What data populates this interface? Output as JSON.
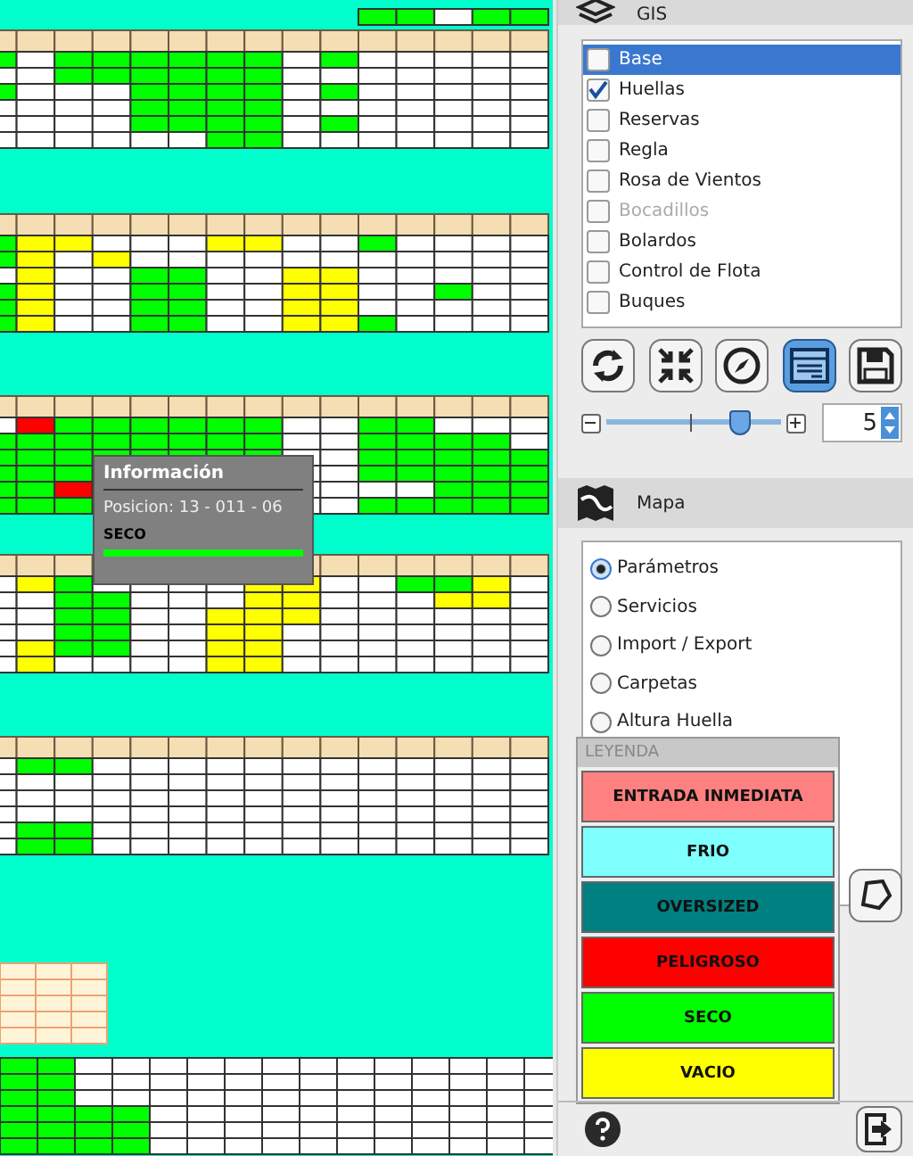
{
  "tooltip": {
    "title": "Información",
    "position": "Posicion: 13 - 011 - 06",
    "status": "SECO"
  },
  "gis": {
    "title": "GIS",
    "layers": [
      {
        "label": "Base",
        "checked": false,
        "selected": true,
        "disabled": false
      },
      {
        "label": "Huellas",
        "checked": true,
        "selected": false,
        "disabled": false
      },
      {
        "label": "Reservas",
        "checked": false,
        "selected": false,
        "disabled": false
      },
      {
        "label": "Regla",
        "checked": false,
        "selected": false,
        "disabled": false
      },
      {
        "label": "Rosa de Vientos",
        "checked": false,
        "selected": false,
        "disabled": false
      },
      {
        "label": "Bocadillos",
        "checked": false,
        "selected": false,
        "disabled": true
      },
      {
        "label": "Bolardos",
        "checked": false,
        "selected": false,
        "disabled": false
      },
      {
        "label": "Control de Flota",
        "checked": false,
        "selected": false,
        "disabled": false
      },
      {
        "label": "Buques",
        "checked": false,
        "selected": false,
        "disabled": false
      }
    ],
    "tools": [
      {
        "kind": "refresh",
        "selected": false
      },
      {
        "kind": "shrink",
        "selected": false
      },
      {
        "kind": "compass",
        "selected": false
      },
      {
        "kind": "table",
        "selected": true
      },
      {
        "kind": "save",
        "selected": false
      }
    ],
    "zoom": {
      "level": 0.77,
      "value": "5"
    }
  },
  "mapa": {
    "title": "Mapa",
    "options": [
      {
        "label": "Parámetros",
        "selected": true
      },
      {
        "label": "Servicios",
        "selected": false
      },
      {
        "label": "Import / Export",
        "selected": false
      },
      {
        "label": "Carpetas",
        "selected": false
      },
      {
        "label": "Altura Huella",
        "selected": false
      }
    ]
  },
  "legend": {
    "title": "LEYENDA",
    "items": [
      {
        "label": "ENTRADA INMEDIATA",
        "color": "#ff8080"
      },
      {
        "label": "FRIO",
        "color": "#80ffff"
      },
      {
        "label": "OVERSIZED",
        "color": "#008080"
      },
      {
        "label": "PELIGROSO",
        "color": "#ff0000"
      },
      {
        "label": "SECO",
        "color": "#00ff00"
      },
      {
        "label": "VACIO",
        "color": "#ffff00"
      }
    ]
  }
}
